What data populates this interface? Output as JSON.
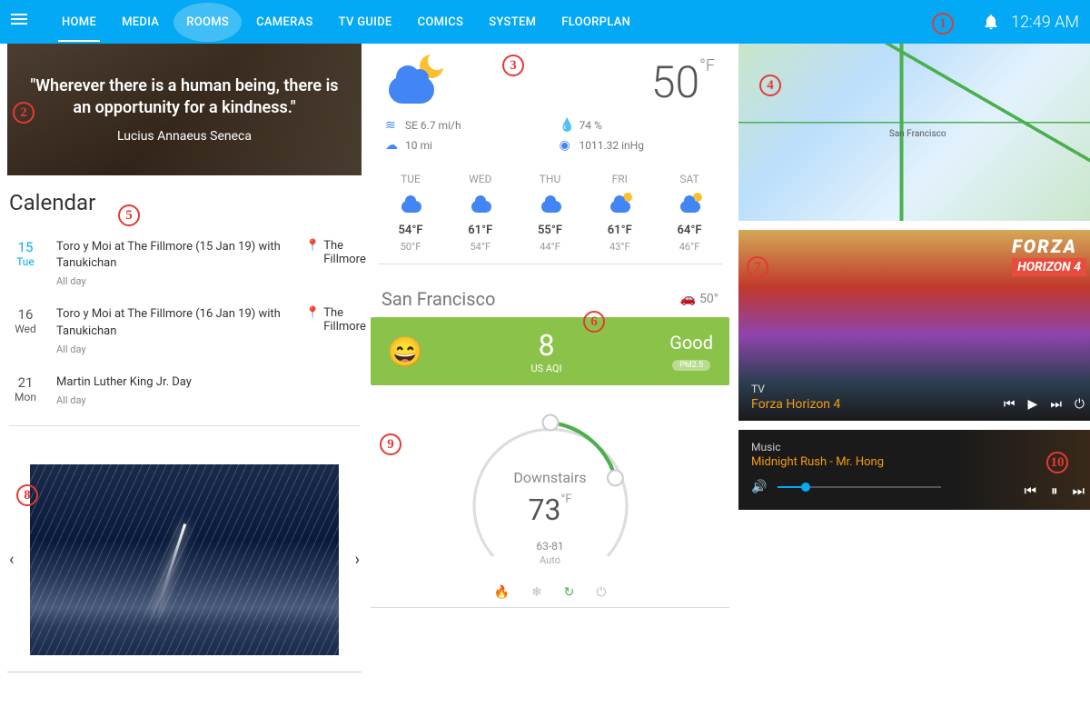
{
  "header": {
    "tabs": [
      "HOME",
      "MEDIA",
      "ROOMS",
      "CAMERAS",
      "TV GUIDE",
      "COMICS",
      "SYSTEM",
      "FLOORPLAN"
    ],
    "active_tab": "HOME",
    "highlight_tab": "ROOMS",
    "time": "12:49 AM"
  },
  "quote": {
    "text": "\"Wherever there is a human being, there is an opportunity for a kindness.\"",
    "author": "Lucius Annaeus Seneca"
  },
  "calendar": {
    "title": "Calendar",
    "events": [
      {
        "date_num": "15",
        "date_day": "Tue",
        "is_today": true,
        "title": "Toro y Moi at The Fillmore (15 Jan 19) with Tanukichan",
        "allday": "All day",
        "location": "The Fillmore"
      },
      {
        "date_num": "16",
        "date_day": "Wed",
        "is_today": false,
        "title": "Toro y Moi at The Fillmore (16 Jan 19) with Tanukichan",
        "allday": "All day",
        "location": "The Fillmore"
      },
      {
        "date_num": "21",
        "date_day": "Mon",
        "is_today": false,
        "title": "Martin Luther King Jr. Day",
        "allday": "All day",
        "location": ""
      }
    ]
  },
  "weather": {
    "temp": "50",
    "temp_unit": "°F",
    "wind": "SE 6.7 mi/h",
    "visibility": "10 mi",
    "humidity": "74 %",
    "pressure": "1011.32 inHg",
    "forecast": [
      {
        "day": "TUE",
        "hi": "54°F",
        "lo": "50°F",
        "moon": false
      },
      {
        "day": "WED",
        "hi": "61°F",
        "lo": "54°F",
        "moon": false
      },
      {
        "day": "THU",
        "hi": "55°F",
        "lo": "44°F",
        "moon": false
      },
      {
        "day": "FRI",
        "hi": "61°F",
        "lo": "43°F",
        "moon": true
      },
      {
        "day": "SAT",
        "hi": "64°F",
        "lo": "46°F",
        "moon": true
      }
    ]
  },
  "aqi": {
    "city": "San Francisco",
    "travel_temp": "50°",
    "value": "8",
    "scale": "US AQI",
    "rating": "Good",
    "pollutant": "PM2.5"
  },
  "thermostat": {
    "name": "Downstairs",
    "temp": "73",
    "unit": "°F",
    "range": "63-81",
    "mode": "Auto"
  },
  "map": {
    "label": "San Francisco"
  },
  "tv": {
    "logo_top": "FORZA",
    "logo_bottom": "HORIZON 4",
    "type": "TV",
    "title": "Forza Horizon 4"
  },
  "music": {
    "type": "Music",
    "title": "Midnight Rush - Mr. Hong",
    "volume_pct": 14
  },
  "annotations": [
    "1",
    "2",
    "3",
    "4",
    "5",
    "6",
    "7",
    "8",
    "9",
    "10"
  ]
}
